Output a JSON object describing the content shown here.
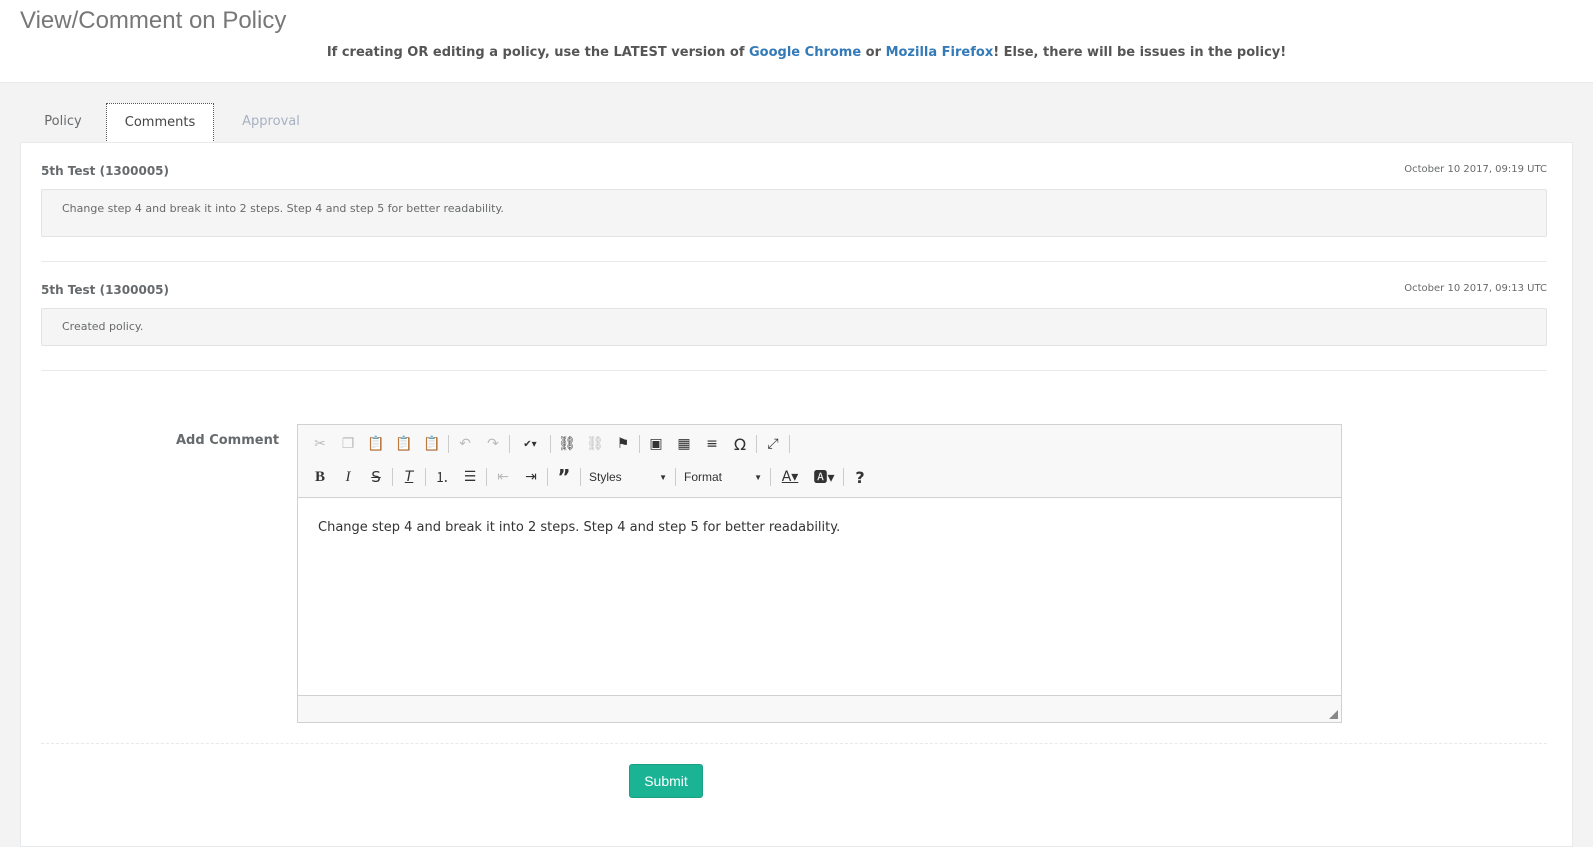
{
  "page": {
    "title": "View/Comment on Policy",
    "notice": {
      "before": "If creating OR editing a policy, use the LATEST version of ",
      "chrome": "Google Chrome",
      "or": " or ",
      "firefox": "Mozilla Firefox",
      "after": "! Else, there will be issues in the policy!"
    }
  },
  "tabs": [
    {
      "label": "Policy",
      "state": "inactive"
    },
    {
      "label": "Comments",
      "state": "active"
    },
    {
      "label": "Approval",
      "state": "disabled"
    }
  ],
  "comments": [
    {
      "author": "5th Test (1300005)",
      "date": "October 10 2017, 09:19 UTC",
      "text": "Change step 4 and break it into 2 steps. Step 4 and step 5 for better readability."
    },
    {
      "author": "5th Test (1300005)",
      "date": "October 10 2017, 09:13 UTC",
      "text": "Created policy."
    }
  ],
  "form": {
    "label": "Add Comment",
    "editor_text": "Change step 4 and break it into 2 steps. Step 4 and step 5 for better readability.",
    "styles_label": "Styles",
    "format_label": "Format",
    "submit_label": "Submit"
  },
  "colors": {
    "link": "#337ab7",
    "accent": "#1ab394",
    "background": "#f3f3f4"
  },
  "icons": {
    "row1": [
      "cut-icon",
      "copy-icon",
      "paste-icon",
      "paste-text-icon",
      "paste-word-icon",
      "undo-icon",
      "redo-icon",
      "spellcheck-icon",
      "link-icon",
      "unlink-icon",
      "anchor-icon",
      "image-icon",
      "table-icon",
      "horizontal-line-icon",
      "special-char-icon",
      "maximize-icon"
    ],
    "row2": [
      "bold-icon",
      "italic-icon",
      "strike-icon",
      "remove-format-icon",
      "numbered-list-icon",
      "bulleted-list-icon",
      "outdent-icon",
      "indent-icon",
      "blockquote-icon",
      "text-color-icon",
      "bg-color-icon",
      "help-icon"
    ]
  }
}
